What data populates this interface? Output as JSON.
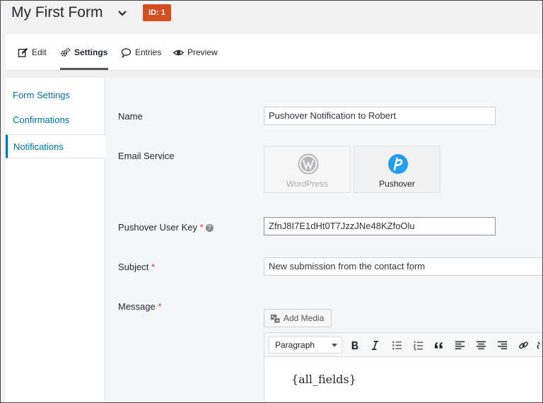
{
  "header": {
    "form_title": "My First Form",
    "id_badge": "ID: 1"
  },
  "nav": {
    "tabs": [
      {
        "label": "Edit",
        "icon": "edit-icon"
      },
      {
        "label": "Settings",
        "icon": "gears-icon",
        "active": true
      },
      {
        "label": "Entries",
        "icon": "comment-icon"
      },
      {
        "label": "Preview",
        "icon": "eye-icon"
      }
    ]
  },
  "sidebar": {
    "items": [
      {
        "label": "Form Settings"
      },
      {
        "label": "Confirmations"
      },
      {
        "label": "Notifications",
        "active": true
      }
    ]
  },
  "fields": {
    "name_label": "Name",
    "name_value": "Pushover Notification to Robert",
    "service_label": "Email Service",
    "services": [
      {
        "label": "WordPress",
        "icon": "wordpress-icon",
        "selected": false
      },
      {
        "label": "Pushover",
        "icon": "pushover-icon",
        "selected": true
      }
    ],
    "user_key_label": "Pushover User Key",
    "user_key_value": "ZfnJ8I7E1dHt0T7JzzJNe48KZfoOlu",
    "subject_label": "Subject",
    "subject_value": "New submission from the contact form",
    "message_label": "Message",
    "required_mark": "*",
    "help_mark": "?"
  },
  "editor": {
    "add_media_label": "Add Media",
    "format_value": "Paragraph",
    "content": "{all_fields}"
  },
  "colors": {
    "badge": "#d54e21",
    "link": "#0073aa",
    "pushover": "#249df1",
    "required": "#dc3232"
  }
}
